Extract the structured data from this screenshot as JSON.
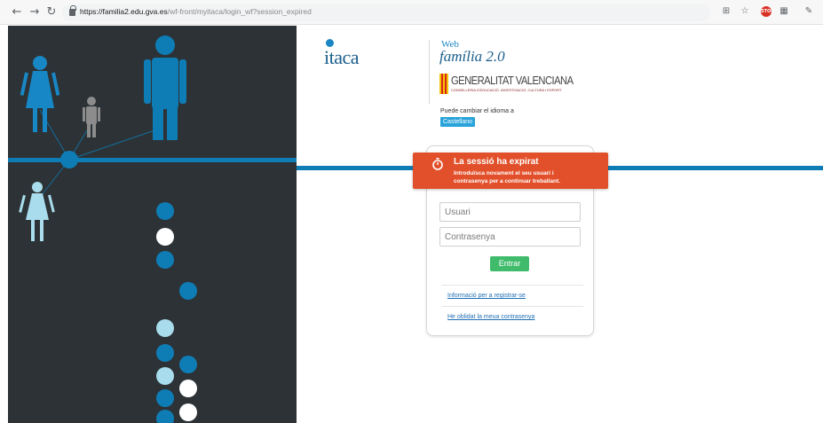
{
  "browser": {
    "back_icon": "arrow-left-icon",
    "forward_icon": "arrow-right-icon",
    "reload_icon": "reload-icon",
    "url_host": "https://familia2.edu.gva.es",
    "url_path": "/wf-front/myitaca/login_wf?session_expired",
    "extensions": [
      "translate-icon",
      "star-icon",
      "stop-icon",
      "extension-icon",
      "pen-icon"
    ]
  },
  "brand": {
    "itaca": "itaca",
    "web": "Web",
    "familia": "família 2.0",
    "gva_name": "GENERALITAT VALENCIANA",
    "gva_sub": "CONSELLERIA D'EDUCACIÓ, INVESTIGACIÓ, CULTURA I ESPORT"
  },
  "language": {
    "label": "Puede cambiar el idioma a",
    "button": "Castellano"
  },
  "alert": {
    "icon": "stopwatch-icon",
    "title": "La sessió ha expirat",
    "message_line1": "Introduïsca novament el seu usuari i",
    "message_line2": "contrasenya per a continuar treballant.",
    "color": "#e2502b"
  },
  "login": {
    "user_placeholder": "Usuari",
    "password_placeholder": "Contrasenya",
    "submit": "Entrar",
    "link_register": "Informació per a registrar-se",
    "link_forgot": "He oblidat la meua contrasenya"
  },
  "colors": {
    "accent_blue": "#0f7db5",
    "dark_panel": "#2c3236",
    "light_blue": "#a9dcec",
    "grey_figure": "#8c8c8c",
    "green_button": "#3fbb6b"
  }
}
